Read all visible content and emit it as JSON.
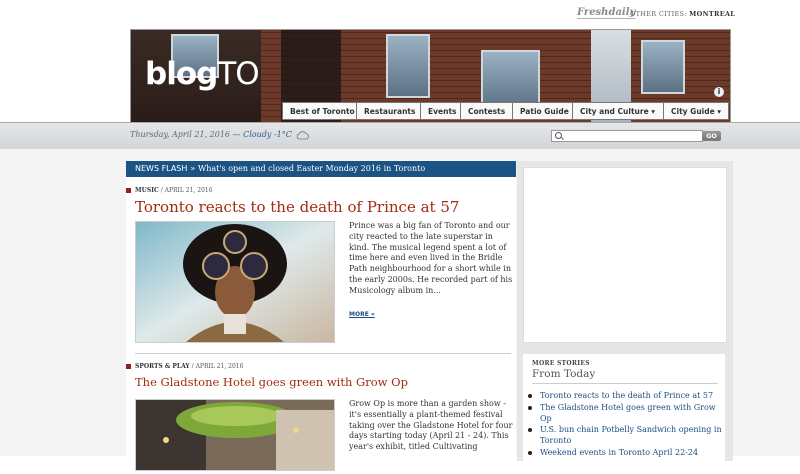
{
  "topbar": {
    "brand": "Freshdaily",
    "other_cities_label": "OTHER CITIES:",
    "other_city": "MONTREAL"
  },
  "header": {
    "logo_main": "blog",
    "logo_suffix": "TO",
    "info_icon": "i"
  },
  "nav": [
    {
      "label": "Best of Toronto"
    },
    {
      "label": "Restaurants"
    },
    {
      "label": "Events"
    },
    {
      "label": "Contests"
    },
    {
      "label": "Patio Guide"
    },
    {
      "label": "City and Culture ▾"
    },
    {
      "label": "City Guide ▾"
    }
  ],
  "datebar": {
    "date": "Thursday, April 21, 2016 —",
    "weather": "Cloudy -1°C",
    "weather_icon": "cloud-icon",
    "search_placeholder": "",
    "go_label": "GO"
  },
  "newsflash": {
    "label": "NEWS FLASH",
    "separator": "»",
    "text": "What's open and closed Easter Monday 2016 in Toronto"
  },
  "articles": [
    {
      "category": "MUSIC",
      "date": "/ APRIL 21, 2016",
      "title": "Toronto reacts to the death of Prince at 57",
      "excerpt": "Prince was a big fan of Toronto and our city reacted to the late superstar in kind. The musical legend spent a lot of time here and even lived in the Bridle Path neighbourhood for a short while in the early 2000s. He recorded part of his Musicology album in...",
      "more": "MORE »"
    },
    {
      "category": "SPORTS & PLAY",
      "date": "/ APRIL 21, 2016",
      "title": "The Gladstone Hotel goes green with Grow Op",
      "excerpt": "Grow Op is more than a garden show - it's essentially a plant-themed festival taking over the Gladstone Hotel for four days starting today (April 21 - 24). This year's exhibit, titled Cultivating"
    }
  ],
  "more_stories": {
    "label": "MORE STORIES",
    "subtitle": "From Today",
    "items": [
      "Toronto reacts to the death of Prince at 57",
      "The Gladstone Hotel goes green with Grow Op",
      "U.S. bun chain Potbelly Sandwich opening in Toronto",
      "Weekend events in Toronto April 22-24"
    ]
  },
  "colors": {
    "accent_blue": "#1b5385",
    "headline_red": "#a42a12",
    "link_blue": "#1b4f80"
  }
}
